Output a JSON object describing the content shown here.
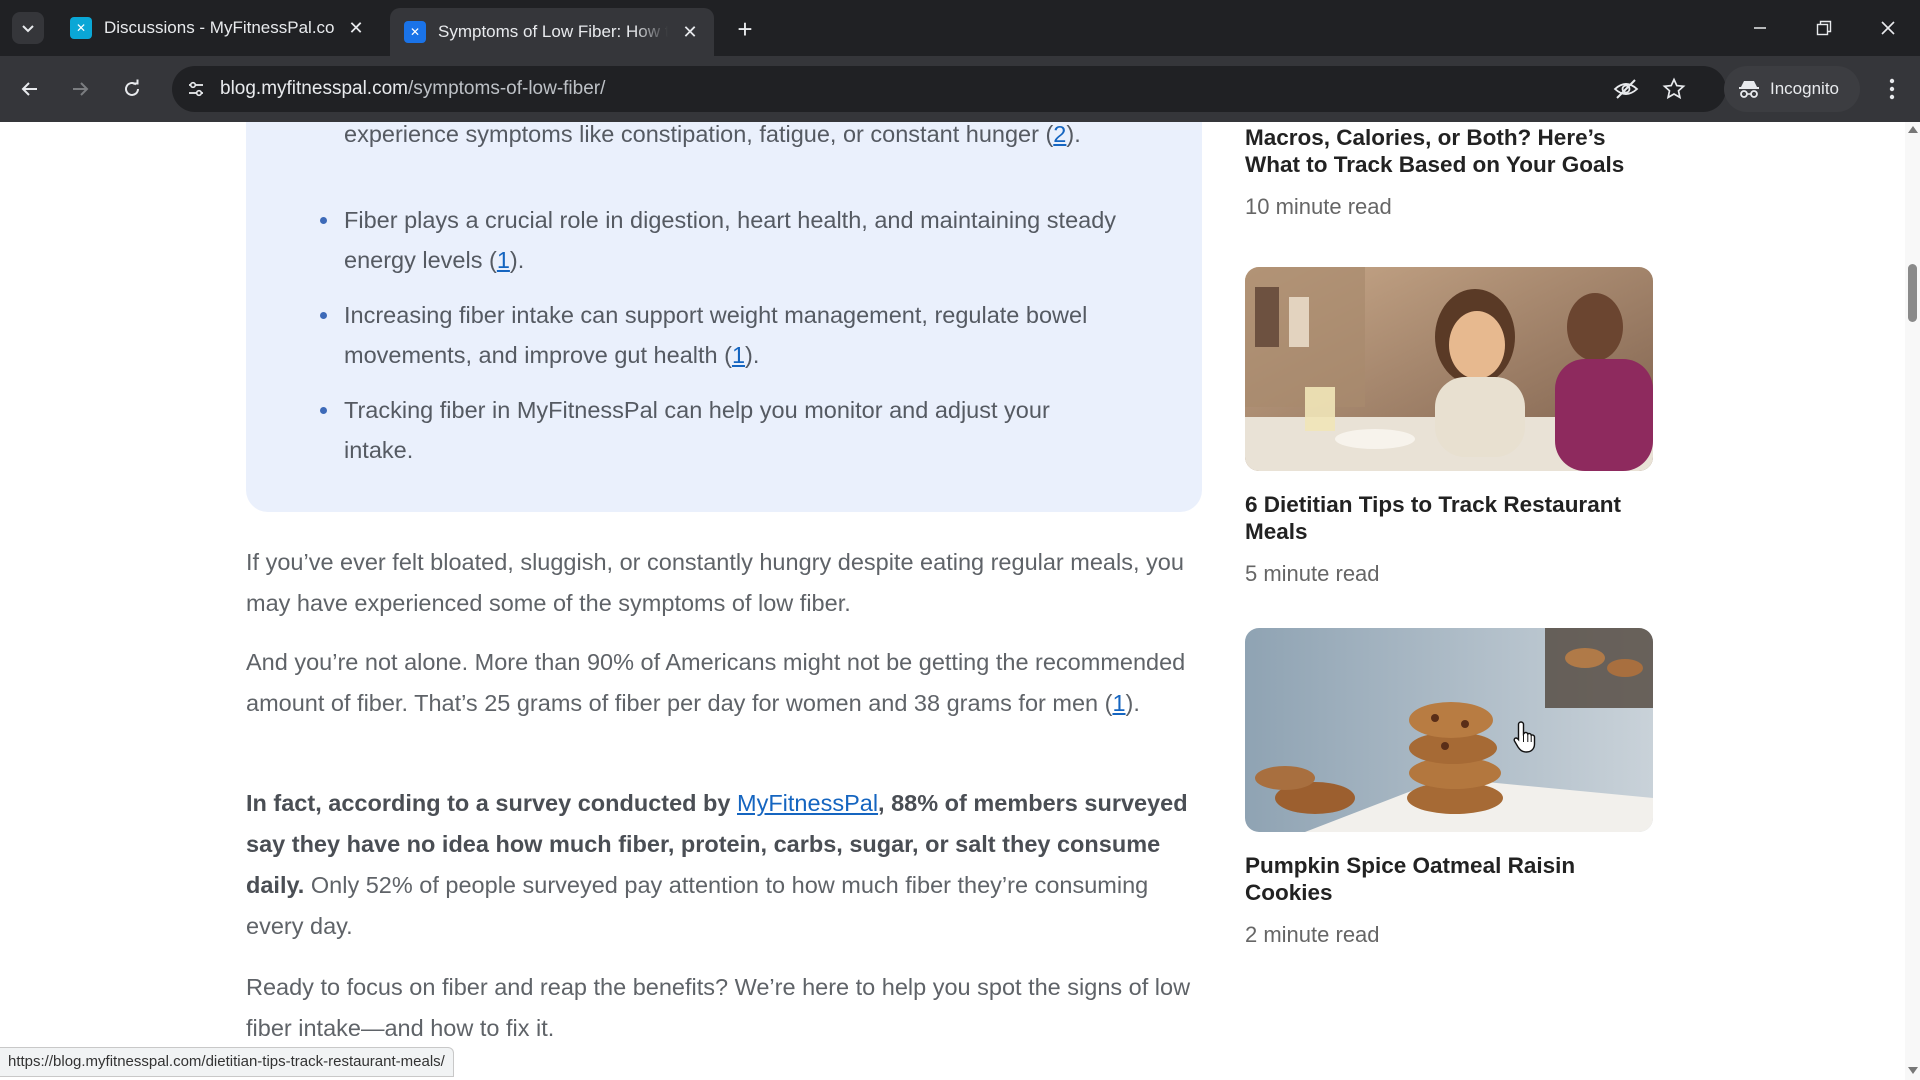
{
  "browser": {
    "tabs": [
      {
        "title": "Discussions - MyFitnessPal.com",
        "active": false
      },
      {
        "title": "Symptoms of Low Fiber: How to Fix It",
        "active": true
      }
    ],
    "url_host": "blog.myfitnesspal.com",
    "url_path": "/symptoms-of-low-fiber/",
    "incognito_label": "Incognito",
    "status_url": "https://blog.myfitnesspal.com/dietitian-tips-track-restaurant-meals/"
  },
  "takeaways": {
    "partial_top": "experience symptoms like constipation, fatigue, or constant hunger (",
    "partial_top_cite": "2",
    "partial_top_end": ").",
    "items": [
      {
        "text": "Fiber plays a crucial role in digestion, heart health, and maintaining steady energy levels (",
        "cite": "1",
        "end": ")."
      },
      {
        "text": "Increasing fiber intake can support weight management, regulate bowel movements, and improve gut health (",
        "cite": "1",
        "end": ")."
      },
      {
        "text": "Tracking fiber in MyFitnessPal can help you monitor and adjust your intake.",
        "cite": "",
        "end": ""
      }
    ]
  },
  "article": {
    "p1": "If you’ve ever felt bloated, sluggish, or constantly hungry despite eating regular meals, you may have experienced some of the symptoms of low fiber.",
    "p2_text": "And you’re not alone. More than 90% of Americans might not be getting the recommended amount of fiber. That’s 25 grams of fiber per day for women and 38 grams for men (",
    "p2_cite": "1",
    "p2_end": ").",
    "p3_bold_start": "In fact, according to a survey conducted by ",
    "p3_link": "MyFitnessPal",
    "p3_bold_end": ", 88% of members surveyed say they have no idea how much fiber, protein, carbs, sugar, or salt they consume daily.",
    "p3_rest": " Only 52% of people surveyed pay attention to how much fiber they’re consuming every day.",
    "p4": "Ready to focus on fiber and reap the benefits?  We’re here to help you spot the signs of low fiber intake—and how to fix it."
  },
  "sidebar": {
    "cards": [
      {
        "title": "Macros, Calories, or Both? Here’s What to Track Based on Your Goals",
        "meta": "10 minute read"
      },
      {
        "title": "6 Dietitian Tips to Track Restaurant Meals",
        "meta": "5 minute read"
      },
      {
        "title": "Pumpkin Spice Oatmeal Raisin Cookies",
        "meta": "2 minute read"
      }
    ]
  },
  "colors": {
    "accent_link": "#1565c0",
    "takeaway_bg": "#eaf0fc",
    "chrome_dark": "#202124"
  }
}
